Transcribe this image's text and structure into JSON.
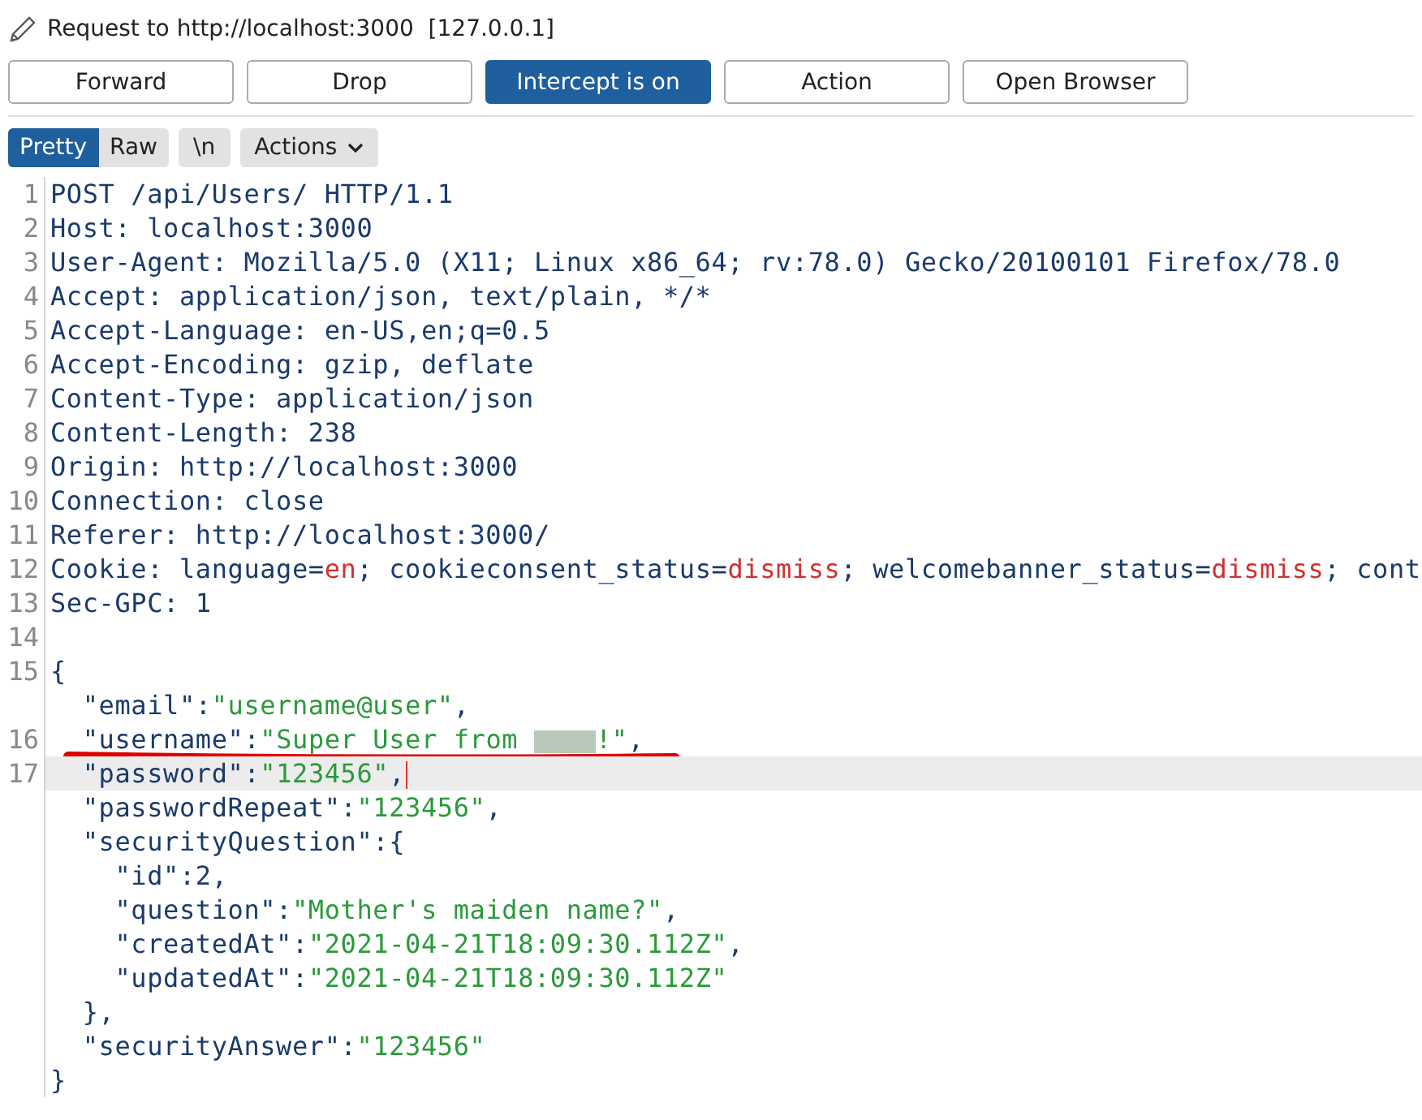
{
  "header": {
    "title": "Request to http://localhost:3000  [127.0.0.1]"
  },
  "buttons": [
    {
      "label": "Forward",
      "on": false
    },
    {
      "label": "Drop",
      "on": false
    },
    {
      "label": "Intercept is on",
      "on": true
    },
    {
      "label": "Action",
      "on": false
    },
    {
      "label": "Open Browser",
      "on": false
    }
  ],
  "view_tabs": [
    {
      "label": "Pretty",
      "selected": true
    },
    {
      "label": "Raw",
      "selected": false
    }
  ],
  "toolbar_buttons": [
    {
      "label": "\\n",
      "kind": "toggle"
    },
    {
      "label": "Actions",
      "kind": "menu"
    }
  ],
  "editor": {
    "lines": [
      {
        "number": "1",
        "segments": [
          {
            "kind": "plain",
            "text": "POST /api/Users/ HTTP/1.1"
          }
        ]
      },
      {
        "number": "2",
        "segments": [
          {
            "kind": "plain",
            "text": "Host: localhost:3000"
          }
        ]
      },
      {
        "number": "3",
        "segments": [
          {
            "kind": "plain",
            "text": "User-Agent: Mozilla/5.0 (X11; Linux x86_64; rv:78.0) Gecko/20100101 Firefox/78.0"
          }
        ]
      },
      {
        "number": "4",
        "segments": [
          {
            "kind": "plain",
            "text": "Accept: application/json, text/plain, */*"
          }
        ]
      },
      {
        "number": "5",
        "segments": [
          {
            "kind": "plain",
            "text": "Accept-Language: en-US,en;q=0.5"
          }
        ]
      },
      {
        "number": "6",
        "segments": [
          {
            "kind": "plain",
            "text": "Accept-Encoding: gzip, deflate"
          }
        ]
      },
      {
        "number": "7",
        "segments": [
          {
            "kind": "plain",
            "text": "Content-Type: application/json"
          }
        ]
      },
      {
        "number": "8",
        "segments": [
          {
            "kind": "plain",
            "text": "Content-Length: 238"
          }
        ]
      },
      {
        "number": "9",
        "segments": [
          {
            "kind": "plain",
            "text": "Origin: http://localhost:3000"
          }
        ]
      },
      {
        "number": "10",
        "segments": [
          {
            "kind": "plain",
            "text": "Connection: close"
          }
        ]
      },
      {
        "number": "11",
        "segments": [
          {
            "kind": "plain",
            "text": "Referer: http://localhost:3000/"
          }
        ]
      },
      {
        "number": "12",
        "segments": [
          {
            "kind": "plain",
            "text": "Cookie: language="
          },
          {
            "kind": "param",
            "text": "en"
          },
          {
            "kind": "plain",
            "text": "; cookieconsent_status="
          },
          {
            "kind": "param",
            "text": "dismiss"
          },
          {
            "kind": "plain",
            "text": "; welcomebanner_status="
          },
          {
            "kind": "param",
            "text": "dismiss"
          },
          {
            "kind": "plain",
            "text": "; cont"
          }
        ]
      },
      {
        "number": "13",
        "segments": [
          {
            "kind": "plain",
            "text": "Sec-GPC: 1"
          }
        ]
      },
      {
        "number": "14"
      },
      {
        "number": "15",
        "segments": [
          {
            "kind": "plain",
            "text": "{"
          }
        ]
      },
      {
        "segments": [
          {
            "kind": "plain",
            "text": "  \"email\":"
          },
          {
            "kind": "string",
            "text": "\"username@user\""
          },
          {
            "kind": "plain",
            "text": ","
          }
        ]
      },
      {
        "number": "16",
        "underlined": true,
        "segments": [
          {
            "kind": "plain",
            "text": "  \"username\":"
          },
          {
            "kind": "string",
            "text": "\"Super User from "
          },
          {
            "kind": "redacted"
          },
          {
            "kind": "string",
            "text": "!\""
          },
          {
            "kind": "plain",
            "text": ","
          }
        ]
      },
      {
        "number": "17",
        "current": true,
        "segments": [
          {
            "kind": "plain",
            "text": "  \"password\":"
          },
          {
            "kind": "string",
            "text": "\"123456\""
          },
          {
            "kind": "plain",
            "text": ","
          },
          {
            "kind": "caret"
          }
        ]
      },
      {
        "segments": [
          {
            "kind": "plain",
            "text": "  \"passwordRepeat\":"
          },
          {
            "kind": "string",
            "text": "\"123456\""
          },
          {
            "kind": "plain",
            "text": ","
          }
        ]
      },
      {
        "segments": [
          {
            "kind": "plain",
            "text": "  \"securityQuestion\":{"
          }
        ]
      },
      {
        "segments": [
          {
            "kind": "plain",
            "text": "    \"id\":2,"
          }
        ]
      },
      {
        "segments": [
          {
            "kind": "plain",
            "text": "    \"question\":"
          },
          {
            "kind": "string",
            "text": "\"Mother's maiden name?\""
          },
          {
            "kind": "plain",
            "text": ","
          }
        ]
      },
      {
        "segments": [
          {
            "kind": "plain",
            "text": "    \"createdAt\":"
          },
          {
            "kind": "string",
            "text": "\"2021-04-21T18:09:30.112Z\""
          },
          {
            "kind": "plain",
            "text": ","
          }
        ]
      },
      {
        "segments": [
          {
            "kind": "plain",
            "text": "    \"updatedAt\":"
          },
          {
            "kind": "string",
            "text": "\"2021-04-21T18:09:30.112Z\""
          }
        ]
      },
      {
        "segments": [
          {
            "kind": "plain",
            "text": "  },"
          }
        ]
      },
      {
        "segments": [
          {
            "kind": "plain",
            "text": "  \"securityAnswer\":"
          },
          {
            "kind": "string",
            "text": "\"123456\""
          }
        ]
      },
      {
        "segments": [
          {
            "kind": "plain",
            "text": "}"
          }
        ]
      }
    ]
  }
}
